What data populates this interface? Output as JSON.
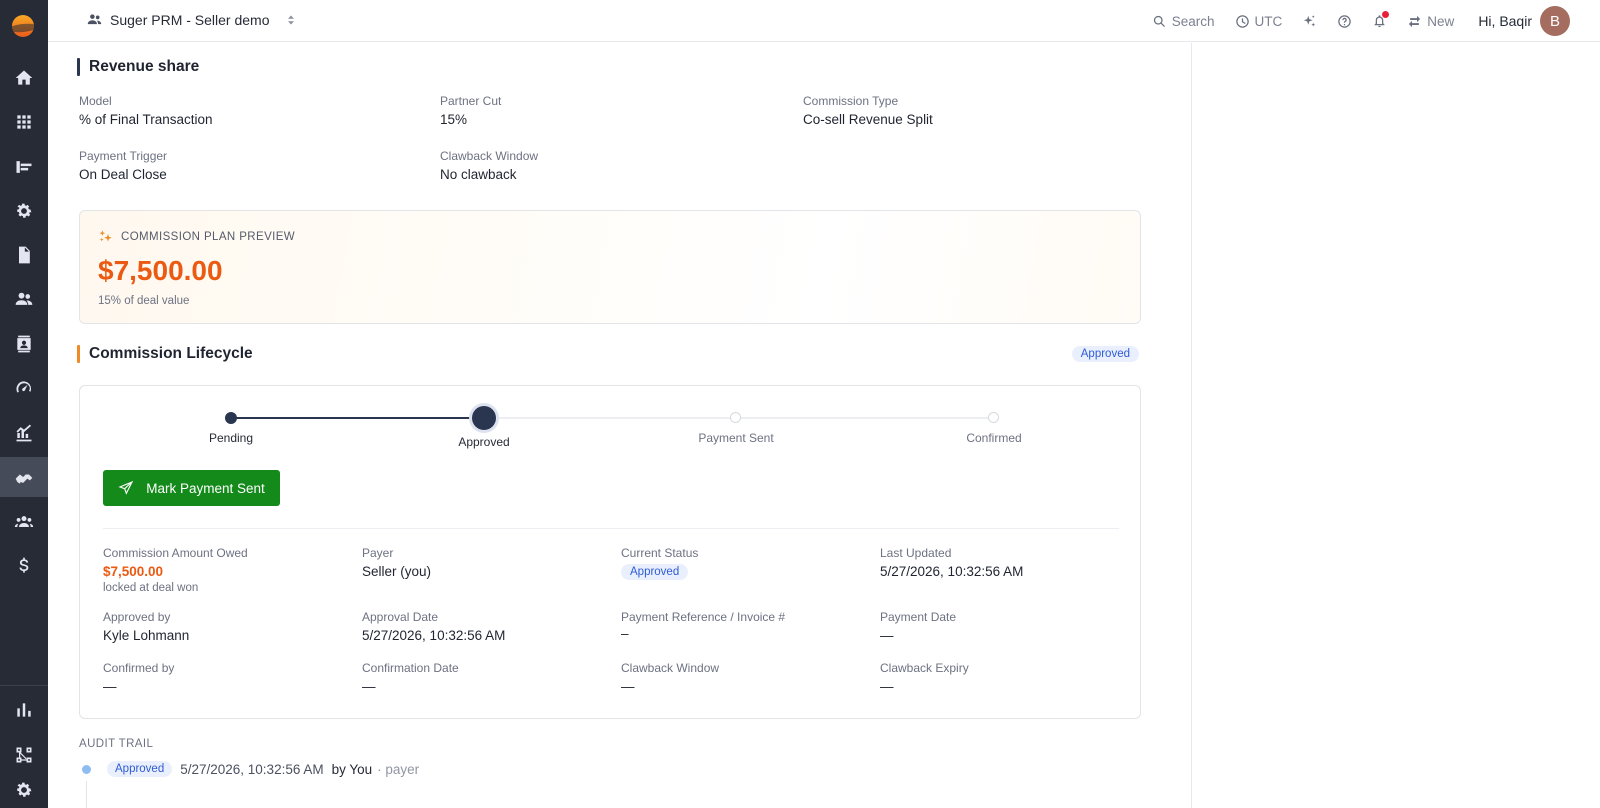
{
  "app": {
    "org_name": "Suger PRM - Seller demo"
  },
  "topbar": {
    "search_label": "Search",
    "timezone_label": "UTC",
    "new_label": "New",
    "greeting": "Hi, Baqir",
    "avatar_initial": "B",
    "notification_dot_color": "#e8213a"
  },
  "sidebar": {
    "items": [
      {
        "icon": "home-icon"
      },
      {
        "icon": "apps-grid-icon"
      },
      {
        "icon": "pipeline-icon"
      },
      {
        "icon": "settings-cog-icon"
      },
      {
        "icon": "document-icon"
      },
      {
        "icon": "people-icon"
      },
      {
        "icon": "contact-card-icon"
      },
      {
        "icon": "speedometer-icon"
      },
      {
        "icon": "trend-chart-icon"
      },
      {
        "icon": "handshake-icon",
        "active": true
      },
      {
        "icon": "groups-icon"
      },
      {
        "icon": "dollar-icon"
      }
    ],
    "bottom_items": [
      {
        "icon": "bar-chart-icon"
      },
      {
        "icon": "workflow-icon"
      },
      {
        "icon": "gear-icon"
      }
    ]
  },
  "revenue_share": {
    "title": "Revenue share",
    "accent_color": "#2a3550",
    "fields": [
      {
        "label": "Model",
        "value": "% of Final Transaction"
      },
      {
        "label": "Partner Cut",
        "value": "15%"
      },
      {
        "label": "Commission Type",
        "value": "Co-sell Revenue Split"
      },
      {
        "label": "Payment Trigger",
        "value": "On Deal Close"
      },
      {
        "label": "Clawback Window",
        "value": "No clawback"
      }
    ]
  },
  "preview": {
    "heading": "COMMISSION PLAN PREVIEW",
    "amount": "$7,500.00",
    "subtitle": "15% of deal value"
  },
  "lifecycle": {
    "title": "Commission Lifecycle",
    "accent_color": "#f08a24",
    "status_badge": "Approved",
    "steps": [
      {
        "label": "Pending",
        "state": "done"
      },
      {
        "label": "Approved",
        "state": "current"
      },
      {
        "label": "Payment Sent",
        "state": "upcoming"
      },
      {
        "label": "Confirmed",
        "state": "upcoming"
      }
    ],
    "action_button": "Mark Payment Sent",
    "fields": {
      "amount_owed": {
        "label": "Commission Amount Owed",
        "value": "$7,500.00",
        "note": "locked at deal won"
      },
      "payer": {
        "label": "Payer",
        "value": "Seller (you)"
      },
      "current_status": {
        "label": "Current Status",
        "value": "Approved"
      },
      "last_updated": {
        "label": "Last Updated",
        "value": "5/27/2026, 10:32:56 AM"
      },
      "approved_by": {
        "label": "Approved by",
        "value": "Kyle Lohmann"
      },
      "approval_date": {
        "label": "Approval Date",
        "value": "5/27/2026, 10:32:56 AM"
      },
      "payment_reference": {
        "label": "Payment Reference / Invoice #",
        "value": "–"
      },
      "payment_date": {
        "label": "Payment Date",
        "value": "—"
      },
      "confirmed_by": {
        "label": "Confirmed by",
        "value": "—"
      },
      "confirmation_date": {
        "label": "Confirmation Date",
        "value": "—"
      },
      "clawback_window": {
        "label": "Clawback Window",
        "value": "—"
      },
      "clawback_expiry": {
        "label": "Clawback Expiry",
        "value": "—"
      }
    }
  },
  "audit": {
    "title": "AUDIT TRAIL",
    "entries": [
      {
        "status": "Approved",
        "timestamp": "5/27/2026, 10:32:56 AM",
        "by": "by You",
        "role": "· payer"
      }
    ]
  }
}
